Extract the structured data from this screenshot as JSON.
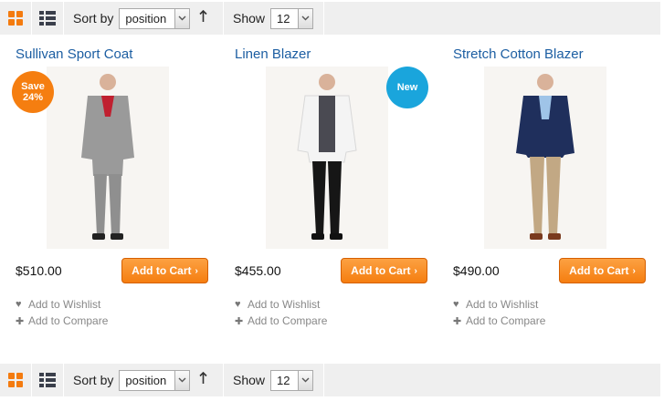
{
  "toolbar": {
    "sort_label": "Sort by",
    "sort_value": "position",
    "direction_icon": "arrow-up-icon",
    "show_label": "Show",
    "show_value": "12"
  },
  "products": [
    {
      "name": "Sullivan Sport Coat",
      "price": "$510.00",
      "badge": "Save 24%",
      "badge_line1": "Save",
      "badge_line2": "24%",
      "cart_label": "Add to Cart",
      "wishlist_label": "Add to Wishlist",
      "compare_label": "Add to Compare"
    },
    {
      "name": "Linen Blazer",
      "price": "$455.00",
      "badge": "New",
      "cart_label": "Add to Cart",
      "wishlist_label": "Add to Wishlist",
      "compare_label": "Add to Compare"
    },
    {
      "name": "Stretch Cotton Blazer",
      "price": "$490.00",
      "cart_label": "Add to Cart",
      "wishlist_label": "Add to Wishlist",
      "compare_label": "Add to Compare"
    }
  ],
  "colors": {
    "accent_orange": "#f57e10",
    "badge_blue": "#1aa5dc",
    "title_blue": "#1c5ea2",
    "toolbar_bg": "#efefef"
  }
}
